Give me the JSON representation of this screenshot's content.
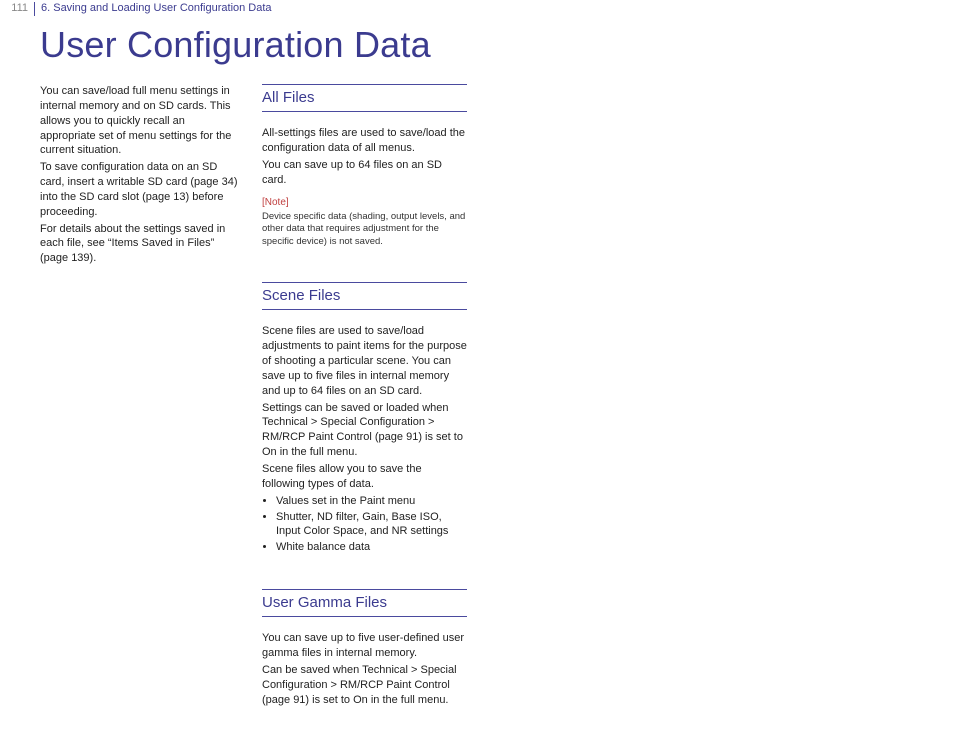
{
  "header": {
    "page": "111",
    "chapter": "6. Saving and Loading User Configuration Data"
  },
  "title": "User Configuration Data",
  "intro": {
    "p1": "You can save/load full menu settings in internal memory and on SD cards. This allows you to quickly recall an appropriate set of menu settings for the current situation.",
    "p2": "To save configuration data on an SD card, insert a writable SD card (page 34) into the SD card slot (page 13) before proceeding.",
    "p3": "For details about the settings saved in each file, see “Items Saved in Files” (page 139)."
  },
  "allfiles": {
    "heading": "All Files",
    "p1": "All-settings files are used to save/load the configuration data of all menus.",
    "p2": "You can save up to 64 files on an SD card.",
    "noteLabel": "[Note]",
    "noteBody": "Device specific data (shading, output levels, and other data that requires adjustment for the specific device) is not saved."
  },
  "scenefiles": {
    "heading": "Scene Files",
    "p1": "Scene files are used to save/load adjustments to paint items for the purpose of shooting a particular scene. You can save up to five files in internal memory and up to 64 files on an SD card.",
    "p2": "Settings can be saved or loaded when Technical > Special Configuration > RM/RCP Paint Control (page 91) is set to On in the full menu.",
    "p3": "Scene files allow you to save the following types of data.",
    "b1": "Values set in the Paint menu",
    "b2": "Shutter, ND filter, Gain, Base ISO, Input Color Space, and NR settings",
    "b3": "White balance data"
  },
  "usergamma": {
    "heading": "User Gamma Files",
    "p1": "You can save up to five user-defined user gamma files in internal memory.",
    "p2": "Can be saved when Technical > Special Configuration > RM/RCP Paint Control (page 91) is set to On in the full menu."
  }
}
